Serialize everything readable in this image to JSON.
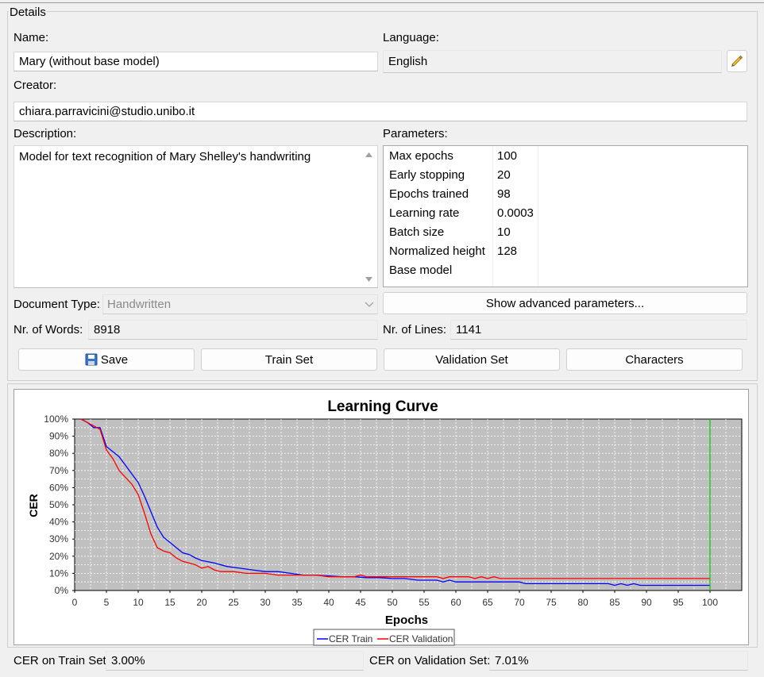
{
  "details": {
    "title": "Details",
    "name_label": "Name:",
    "name_value": "Mary (without base model)",
    "language_label": "Language:",
    "language_value": "English",
    "creator_label": "Creator:",
    "creator_value": "chiara.parravicini@studio.unibo.it",
    "description_label": "Description:",
    "description_value": "Model for text recognition of Mary Shelley's handwriting",
    "parameters_label": "Parameters:",
    "parameters": [
      {
        "key": "Max epochs",
        "value": "100"
      },
      {
        "key": "Early stopping",
        "value": "20"
      },
      {
        "key": "Epochs trained",
        "value": "98"
      },
      {
        "key": "Learning rate",
        "value": "0.0003"
      },
      {
        "key": "Batch size",
        "value": "10"
      },
      {
        "key": "Normalized height",
        "value": "128"
      },
      {
        "key": "Base model",
        "value": ""
      }
    ],
    "doc_type_label": "Document Type:",
    "doc_type_value": "Handwritten",
    "advanced_button": "Show advanced parameters...",
    "words_label": "Nr. of Words:",
    "words_value": "8918",
    "lines_label": "Nr. of Lines:",
    "lines_value": "1141",
    "save_button": "Save",
    "train_set_button": "Train Set",
    "validation_set_button": "Validation Set",
    "characters_button": "Characters"
  },
  "footer": {
    "cer_train_label": "CER on Train Set:",
    "cer_train_value": "3.00%",
    "cer_val_label": "CER on Validation Set:",
    "cer_val_value": "7.01%"
  },
  "icons": {
    "edit": "pencil-icon",
    "save": "floppy-disk-icon"
  },
  "colors": {
    "train": "#0000ff",
    "validation": "#ff0000",
    "marker": "#00cc00",
    "plot_bg": "#c0c0c0"
  },
  "chart_data": {
    "type": "line",
    "title": "Learning Curve",
    "xlabel": "Epochs",
    "ylabel": "CER",
    "xlim": [
      0,
      105
    ],
    "ylim": [
      0,
      100
    ],
    "x_ticks": [
      0,
      5,
      10,
      15,
      20,
      25,
      30,
      35,
      40,
      45,
      50,
      55,
      60,
      65,
      70,
      75,
      80,
      85,
      90,
      95,
      100
    ],
    "y_ticks": [
      "0%",
      "10%",
      "20%",
      "30%",
      "40%",
      "50%",
      "60%",
      "70%",
      "80%",
      "90%",
      "100%"
    ],
    "grid": true,
    "legend": "bottom",
    "marker_x": 100,
    "series": [
      {
        "name": "CER Train",
        "x": [
          1,
          2,
          3,
          4,
          5,
          6,
          7,
          8,
          9,
          10,
          11,
          12,
          13,
          14,
          15,
          16,
          17,
          18,
          19,
          20,
          22,
          24,
          26,
          28,
          30,
          32,
          34,
          36,
          38,
          40,
          42,
          44,
          46,
          48,
          50,
          52,
          54,
          56,
          57,
          58,
          59,
          60,
          62,
          65,
          68,
          70,
          71,
          75,
          80,
          84,
          85,
          86,
          87,
          88,
          89,
          90,
          95,
          100
        ],
        "values": [
          100,
          98,
          95,
          95,
          84,
          81,
          78,
          73,
          68,
          63,
          55,
          46,
          37,
          31,
          28,
          25,
          22,
          21,
          19,
          17.5,
          16,
          14,
          13,
          12,
          11,
          11,
          10,
          9,
          9,
          8.5,
          8,
          8,
          7.5,
          7.5,
          7,
          7,
          6,
          6,
          6,
          5,
          6,
          5,
          5,
          5,
          5,
          5,
          4,
          4,
          4,
          4,
          3,
          4,
          3,
          4,
          3,
          3,
          3,
          3
        ]
      },
      {
        "name": "CER Validation",
        "x": [
          1,
          2,
          3,
          4,
          5,
          6,
          7,
          8,
          9,
          10,
          11,
          12,
          13,
          14,
          15,
          16,
          17,
          18,
          19,
          20,
          21,
          22,
          23,
          25,
          27,
          30,
          32,
          34,
          36,
          38,
          40,
          42,
          44,
          45,
          46,
          48,
          50,
          55,
          57,
          58,
          59,
          60,
          62,
          63,
          64,
          65,
          66,
          67,
          68,
          70,
          75,
          80,
          85,
          90,
          95,
          100
        ],
        "values": [
          100,
          98,
          96,
          94,
          82,
          77,
          70,
          66,
          62,
          56,
          45,
          33,
          25,
          23,
          22,
          19,
          17,
          16,
          15,
          13,
          14,
          12,
          11,
          11,
          10,
          10,
          9,
          9,
          9,
          9,
          8,
          8,
          8,
          9,
          8,
          8,
          8,
          8,
          8,
          7,
          8,
          8,
          8,
          7,
          8,
          7,
          8,
          7,
          7,
          7,
          7,
          7,
          7,
          7,
          7,
          7
        ]
      }
    ]
  }
}
